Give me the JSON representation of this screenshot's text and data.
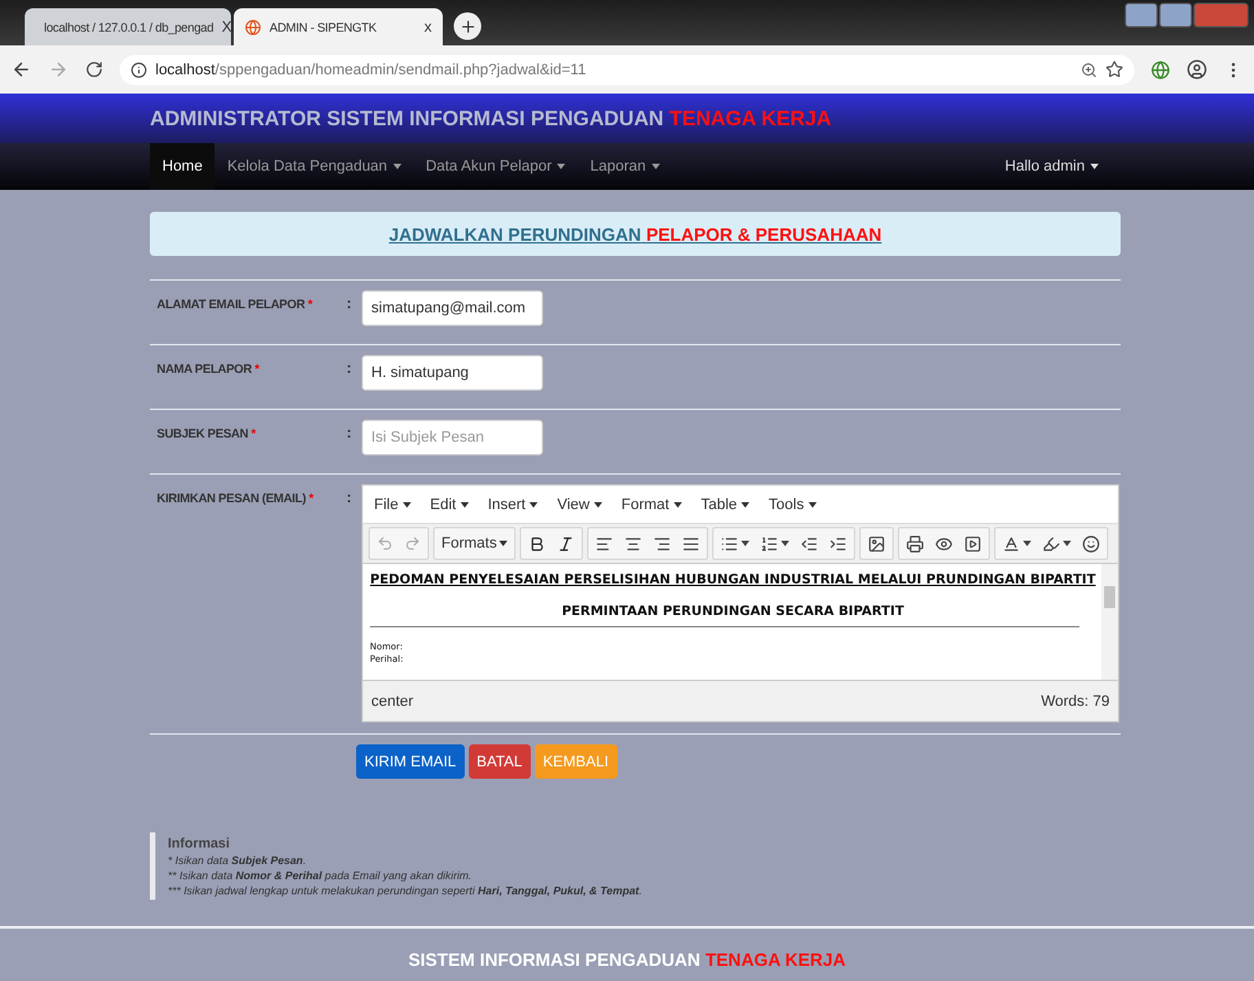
{
  "browser": {
    "tabs": [
      {
        "title": "localhost / 127.0.0.1 / db_pengad",
        "selected": false,
        "close": "X"
      },
      {
        "title": "ADMIN - SIPENGTK",
        "selected": true,
        "close": "x"
      }
    ],
    "url": {
      "host": "localhost",
      "path": "/sppengaduan/homeadmin/sendmail.php?jadwal&id=11"
    }
  },
  "header": {
    "title": "ADMINISTRATOR SISTEM INFORMASI PENGADUAN",
    "highlight": "TENAGA KERJA"
  },
  "nav": {
    "items": [
      {
        "label": "Home",
        "selected": true,
        "dropdown": false
      },
      {
        "label": "Kelola Data Pengaduan",
        "selected": false,
        "dropdown": true
      },
      {
        "label": "Data Akun Pelapor",
        "selected": false,
        "dropdown": true
      },
      {
        "label": "Laporan",
        "selected": false,
        "dropdown": true
      }
    ],
    "user": {
      "label": "Hallo admin",
      "dropdown": true
    }
  },
  "banner": {
    "text": "JADWALKAN PERUNDINGAN",
    "highlight": "PELAPOR & PERUSAHAAN"
  },
  "fields": [
    {
      "label": "ALAMAT EMAIL PELAPOR",
      "required": "*",
      "colon": ":",
      "value": "simatupang@mail.com"
    },
    {
      "label": "NAMA PELAPOR",
      "required": "*",
      "colon": ":",
      "value": "H. simatupang"
    },
    {
      "label": "SUBJEK PESAN",
      "required": "*",
      "colon": ":",
      "placeholder": "Isi Subjek Pesan"
    }
  ],
  "editor_field": {
    "label": "KIRIMKAN PESAN (EMAIL)",
    "required": "*",
    "colon": ":"
  },
  "editor": {
    "menu": [
      "File",
      "Edit",
      "Insert",
      "View",
      "Format",
      "Table",
      "Tools"
    ],
    "formats": "Formats",
    "heading": "PEDOMAN PENYELESAIAN PERSELISIHAN HUBUNGAN INDUSTRIAL MELALUI PRUNDINGAN BIPARTIT",
    "subheading": "PERMINTAAN PERUNDINGAN SECARA BIPARTIT",
    "lines": [
      "Nomor:",
      "Perihal:"
    ],
    "path": "center",
    "word_count": "Words: 79"
  },
  "buttons": [
    {
      "label": "KIRIM EMAIL",
      "color": "#0b62c9"
    },
    {
      "label": "BATAL",
      "color": "#d23a36"
    },
    {
      "label": "KEMBALI",
      "color": "#f59a1e"
    }
  ],
  "info": {
    "title": "Informasi",
    "lines": [
      {
        "mark": "*",
        "text": "Isikan data **Subjek Pesan**."
      },
      {
        "mark": "**",
        "text": "Isikan data **Nomor & Perihal** pada Email yang akan dikirim."
      },
      {
        "mark": "***",
        "text": "Isikan jadwal lengkap untuk melakukan perundingan seperti **Hari, Tanggal, Pukul, & Tempat**."
      }
    ]
  },
  "footer": {
    "text": "SISTEM INFORMASI PENGADUAN",
    "highlight": "TENAGA KERJA"
  }
}
